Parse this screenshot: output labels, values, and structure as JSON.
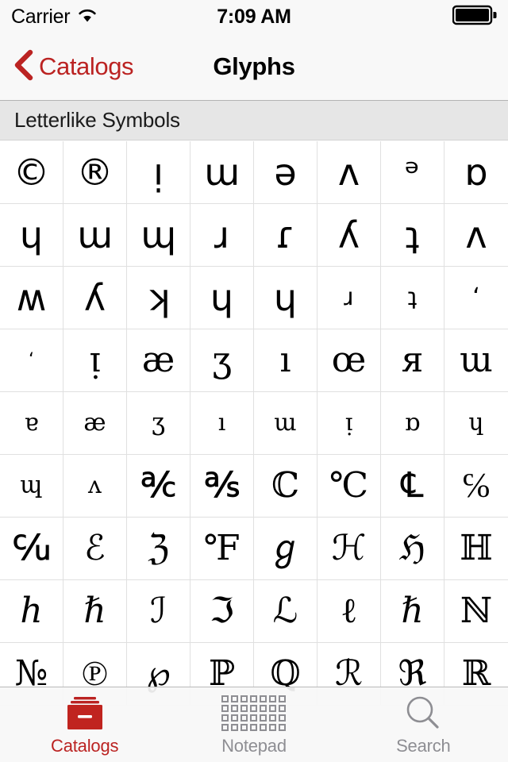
{
  "status_bar": {
    "carrier": "Carrier",
    "wifi_icon": "wifi-icon",
    "time": "7:09 AM",
    "battery_icon": "battery-full-icon"
  },
  "nav_bar": {
    "back_icon": "chevron-left-icon",
    "back_label": "Catalogs",
    "title": "Glyphs",
    "accent_color": "#bb2322"
  },
  "section": {
    "header": "Letterlike Symbols"
  },
  "glyphs": [
    {
      "char": "©",
      "style": "sans"
    },
    {
      "char": "®",
      "style": "sans"
    },
    {
      "char": "ᴉ",
      "style": "sans"
    },
    {
      "char": "ɯ",
      "style": "sans"
    },
    {
      "char": "ə",
      "style": "sans"
    },
    {
      "char": "ʌ",
      "style": "sans"
    },
    {
      "char": "ᵊ",
      "style": "sans"
    },
    {
      "char": "ɒ",
      "style": "sans"
    },
    {
      "char": "ɥ",
      "style": "sans"
    },
    {
      "char": "ɯ",
      "style": "sans"
    },
    {
      "char": "ɰ",
      "style": "sans"
    },
    {
      "char": "ɹ",
      "style": "sans"
    },
    {
      "char": "ɾ",
      "style": "sans"
    },
    {
      "char": "ʎ",
      "style": "sans"
    },
    {
      "char": "ʇ",
      "style": "sans"
    },
    {
      "char": "ʌ",
      "style": "sans"
    },
    {
      "char": "ʍ",
      "style": "sans"
    },
    {
      "char": "ʎ",
      "style": "sans"
    },
    {
      "char": "ʞ",
      "style": "sans"
    },
    {
      "char": "ɥ",
      "style": "sans"
    },
    {
      "char": "ɥ",
      "style": "sans"
    },
    {
      "char": "ɹ",
      "style": "sans small"
    },
    {
      "char": "ʇ",
      "style": "sans small"
    },
    {
      "char": "‘",
      "style": "sans small"
    },
    {
      "char": "‘",
      "style": "sans tiny"
    },
    {
      "char": "ᴉ",
      "style": ""
    },
    {
      "char": "æ",
      "style": ""
    },
    {
      "char": "ʒ",
      "style": ""
    },
    {
      "char": "ı",
      "style": ""
    },
    {
      "char": "œ",
      "style": ""
    },
    {
      "char": "я",
      "style": ""
    },
    {
      "char": "ɯ",
      "style": ""
    },
    {
      "char": "ɐ",
      "style": "small"
    },
    {
      "char": "æ",
      "style": "small"
    },
    {
      "char": "ʒ",
      "style": "small"
    },
    {
      "char": "ı",
      "style": "small"
    },
    {
      "char": "ɯ",
      "style": "small"
    },
    {
      "char": "ᴉ",
      "style": "small"
    },
    {
      "char": "ɒ",
      "style": "small"
    },
    {
      "char": "ɥ",
      "style": "small"
    },
    {
      "char": "ɰ",
      "style": "small"
    },
    {
      "char": "ʌ",
      "style": "small"
    },
    {
      "char": "℀",
      "style": ""
    },
    {
      "char": "℁",
      "style": ""
    },
    {
      "char": "ℂ",
      "style": ""
    },
    {
      "char": "℃",
      "style": ""
    },
    {
      "char": "℄",
      "style": ""
    },
    {
      "char": "℅",
      "style": ""
    },
    {
      "char": "℆",
      "style": ""
    },
    {
      "char": "ℰ",
      "style": ""
    },
    {
      "char": "ℨ",
      "style": ""
    },
    {
      "char": "℉",
      "style": ""
    },
    {
      "char": "ℊ",
      "style": ""
    },
    {
      "char": "ℋ",
      "style": ""
    },
    {
      "char": "ℌ",
      "style": ""
    },
    {
      "char": "ℍ",
      "style": ""
    },
    {
      "char": "ℎ",
      "style": ""
    },
    {
      "char": "ℏ",
      "style": ""
    },
    {
      "char": "ℐ",
      "style": ""
    },
    {
      "char": "ℑ",
      "style": ""
    },
    {
      "char": "ℒ",
      "style": ""
    },
    {
      "char": "ℓ",
      "style": ""
    },
    {
      "char": "ℏ",
      "style": ""
    },
    {
      "char": "ℕ",
      "style": ""
    },
    {
      "char": "№",
      "style": ""
    },
    {
      "char": "℗",
      "style": ""
    },
    {
      "char": "℘",
      "style": ""
    },
    {
      "char": "ℙ",
      "style": ""
    },
    {
      "char": "ℚ",
      "style": ""
    },
    {
      "char": "ℛ",
      "style": ""
    },
    {
      "char": "ℜ",
      "style": ""
    },
    {
      "char": "ℝ",
      "style": ""
    }
  ],
  "tab_bar": {
    "items": [
      {
        "label": "Catalogs",
        "icon": "catalog-box-icon",
        "active": true
      },
      {
        "label": "Notepad",
        "icon": "grid-dots-icon",
        "active": false
      },
      {
        "label": "Search",
        "icon": "magnifier-icon",
        "active": false
      }
    ],
    "active_color": "#bb2322",
    "inactive_color": "#8e8e93"
  }
}
